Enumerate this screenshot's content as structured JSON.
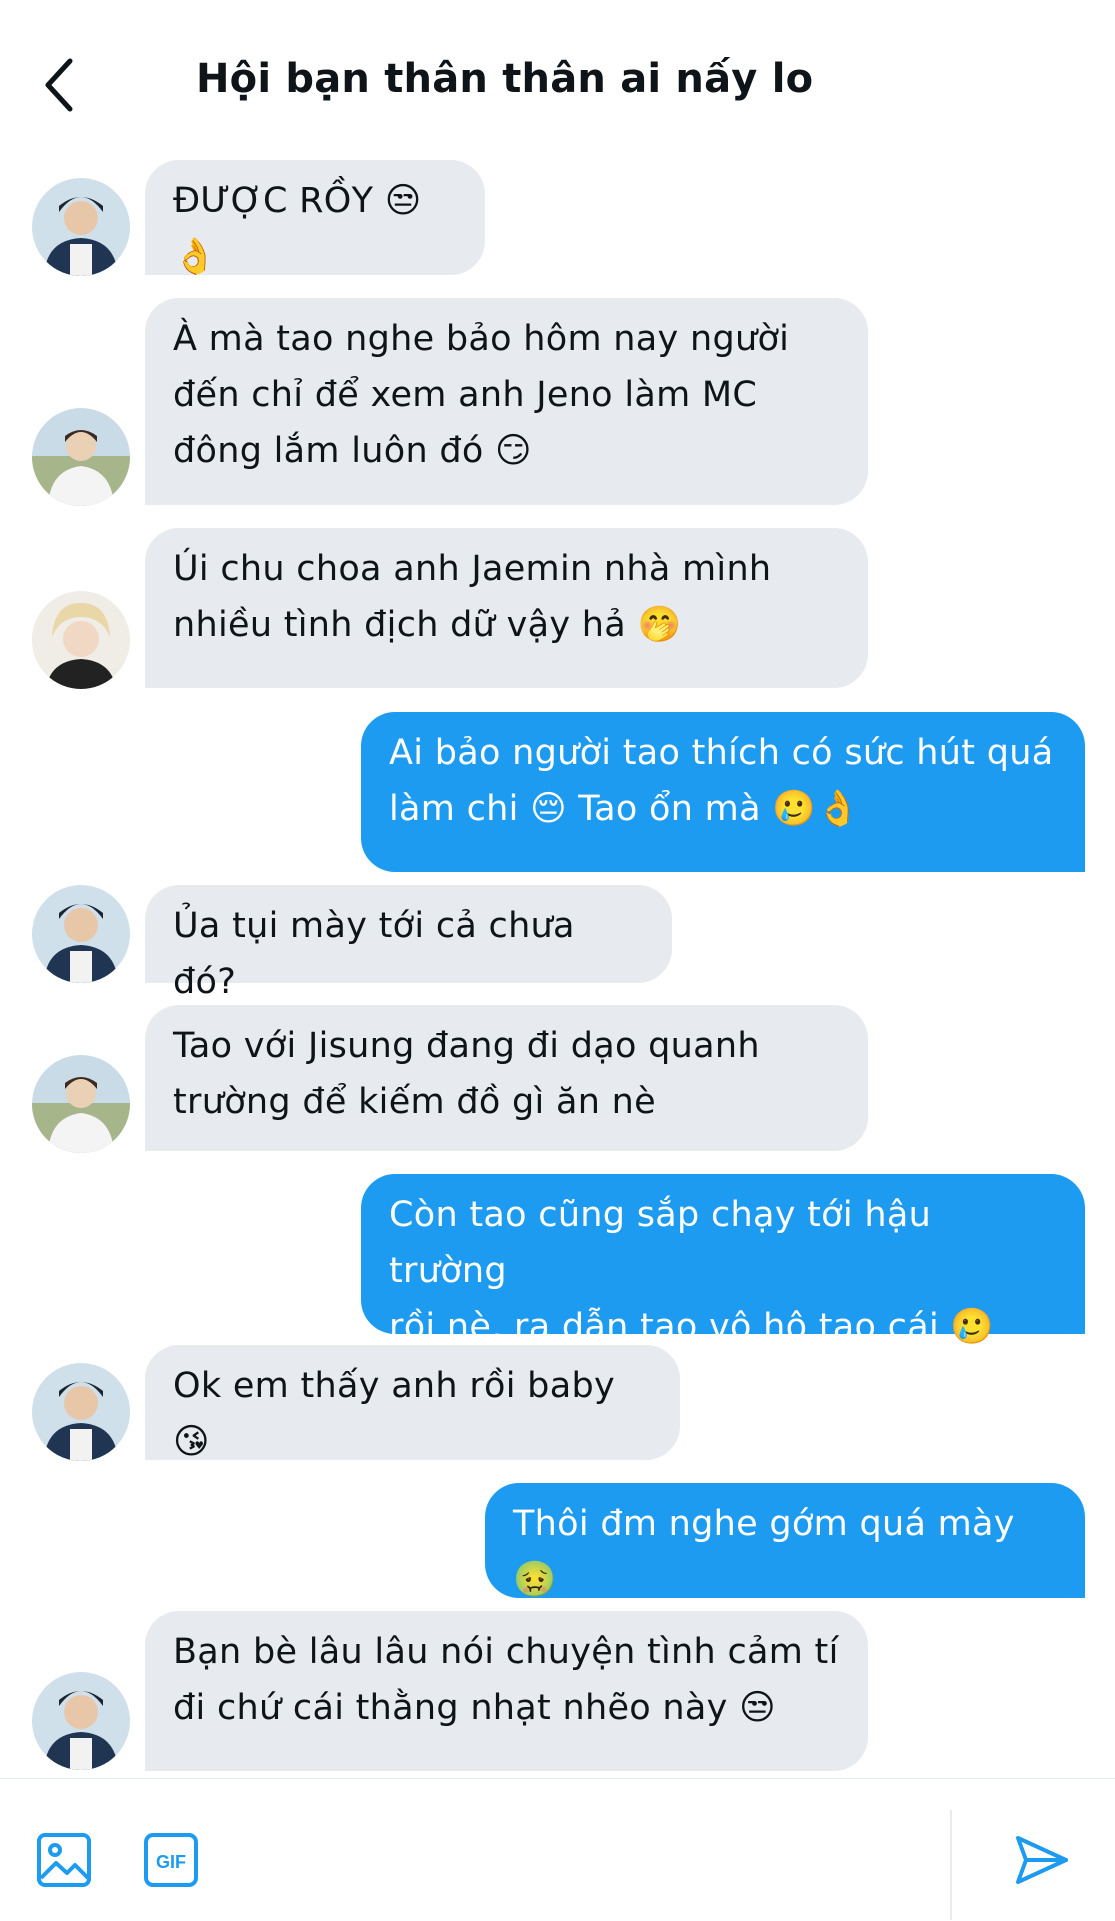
{
  "header": {
    "title": "Hội bạn thân thân ai nấy lo"
  },
  "colors": {
    "accent": "#1d9bf0",
    "incoming_bubble": "#e7eaee",
    "text": "#0f1419"
  },
  "messages": [
    {
      "dir": "in",
      "sender": "user-a",
      "text": "ĐƯỢC RỒY 😒👌"
    },
    {
      "dir": "in",
      "sender": "user-b",
      "text": "À mà tao nghe bảo hôm nay người\nđến chỉ để xem anh Jeno làm MC\nđông lắm luôn đó 😏"
    },
    {
      "dir": "in",
      "sender": "user-c",
      "text": "Úi chu choa anh Jaemin nhà mình\nnhiều tình địch dữ vậy hả 🤭"
    },
    {
      "dir": "out",
      "text": "Ai bảo người tao thích có sức hút quá\nlàm chi 😔 Tao ổn mà 🥲👌"
    },
    {
      "dir": "in",
      "sender": "user-a",
      "text": "Ủa tụi mày tới cả chưa đó?"
    },
    {
      "dir": "in",
      "sender": "user-b",
      "text": "Tao với Jisung đang đi dạo quanh\ntrường để kiếm đồ gì ăn nè"
    },
    {
      "dir": "out",
      "text": "Còn tao cũng sắp chạy tới hậu trường\nrồi nè, ra dẫn tao vô hộ tao cái 🥲"
    },
    {
      "dir": "in",
      "sender": "user-a",
      "text": "Ok em thấy anh rồi baby 😘"
    },
    {
      "dir": "out",
      "text": "Thôi đm nghe gớm quá mày 🤢"
    },
    {
      "dir": "in",
      "sender": "user-a",
      "text": "Bạn bè lâu lâu nói chuyện tình cảm tí\nđi chứ cái thằng nhạt nhẽo này 😒"
    }
  ],
  "composer": {
    "gif_label": "GIF"
  }
}
